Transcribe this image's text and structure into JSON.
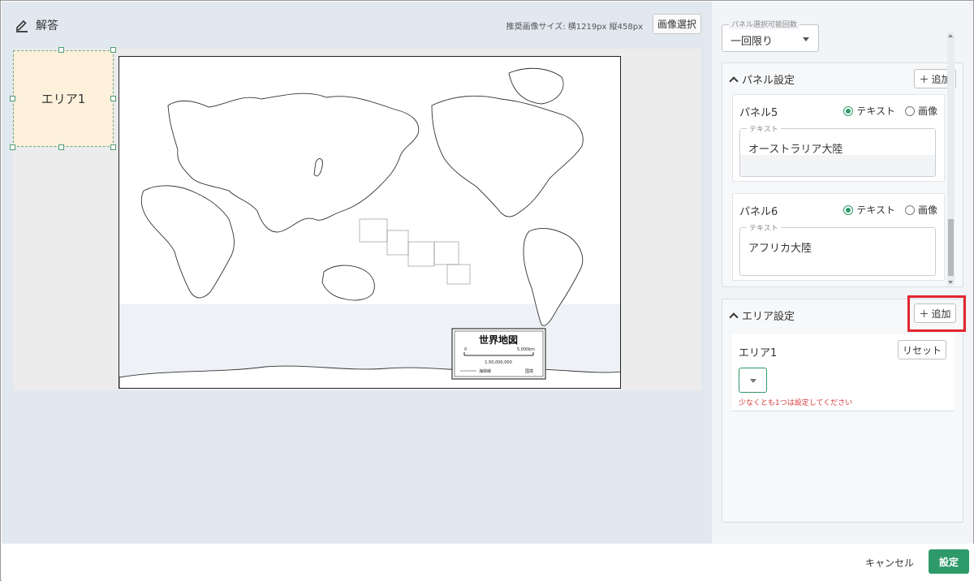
{
  "header": {
    "title": "解答",
    "icon": "edit-icon"
  },
  "image_hint": "推奨画像サイズ: 横1219px 縦458px",
  "image_select_label": "画像選択",
  "map": {
    "title": "世界地図",
    "scale_start": "0",
    "scale_end": "5,000km",
    "scale_ratio": "1:50,000,000",
    "legend_coast": "海岸線",
    "legend_border": "国境"
  },
  "area_box_label": "エリア1",
  "panel_select": {
    "label": "パネル選択可能回数",
    "value": "一回限り"
  },
  "panel_settings": {
    "title": "パネル設定",
    "add_label": "追加",
    "items": [
      {
        "name": "パネル5",
        "opt_text": "テキスト",
        "opt_image": "画像",
        "field_label": "テキスト",
        "value": "オーストラリア大陸"
      },
      {
        "name": "パネル6",
        "opt_text": "テキスト",
        "opt_image": "画像",
        "field_label": "テキスト",
        "value": "アフリカ大陸"
      }
    ]
  },
  "area_settings": {
    "title": "エリア設定",
    "add_label": "追加",
    "items": [
      {
        "name": "エリア1",
        "reset_label": "リセット",
        "error": "少なくとも1つは設定してください"
      }
    ]
  },
  "footer": {
    "cancel": "キャンセル",
    "ok": "設定"
  },
  "colors": {
    "accent": "#2e9a69",
    "error": "#d83a3a",
    "highlight": "#e3262f",
    "area_fill": "#fdf1dc"
  }
}
